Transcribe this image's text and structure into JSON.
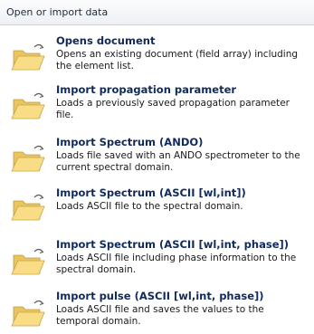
{
  "header": {
    "title": "Open or import data"
  },
  "items": [
    {
      "title": "Opens document",
      "desc": "Opens an existing document (field array) including the element list."
    },
    {
      "title": "Import propagation parameter",
      "desc": "Loads a previously saved propagation parameter file."
    },
    {
      "title": "Import Spectrum (ANDO)",
      "desc": "Loads file saved with an ANDO spectrometer to the current spectral domain."
    },
    {
      "title": "Import Spectrum (ASCII [wl,int])",
      "desc": "Loads ASCII file to the spectral domain."
    },
    {
      "title": "Import Spectrum (ASCII [wl,int, phase])",
      "desc": "Loads ASCII file including phase information to the spectral domain."
    },
    {
      "title": "Import pulse (ASCII [wl,int, phase])",
      "desc": "Loads ASCII file and saves the values to the temporal domain."
    }
  ],
  "icons": {
    "item_icon": "open-folder-icon"
  },
  "colors": {
    "title": "#102a5c",
    "header_bg": "#eef1f5",
    "folder_back": "#e9c45f",
    "folder_front": "#f8dc86"
  }
}
